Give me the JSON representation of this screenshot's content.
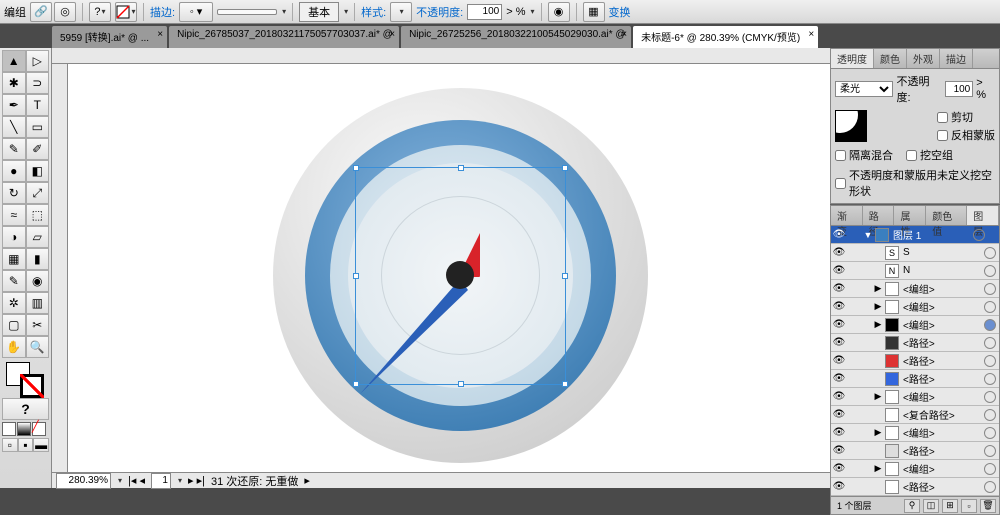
{
  "topbar": {
    "menu_label": "编组",
    "stroke_label": "描边:",
    "basic_label": "基本",
    "style_label": "样式:",
    "opacity_label": "不透明度:",
    "opacity_value": "100",
    "transform_label": "变换"
  },
  "tabs": [
    {
      "name": "5959 [转换].ai* @ ..."
    },
    {
      "name": "Nipic_26785037_20180321175057703037.ai* @"
    },
    {
      "name": "Nipic_26725256_20180322100545029030.ai* @"
    },
    {
      "name": "未标题-6* @ 280.39% (CMYK/预览)"
    }
  ],
  "active_tab": 3,
  "status": {
    "zoom": "280.39%",
    "page": "1",
    "undo_label": "31 次还原: 无重做"
  },
  "trans_panel": {
    "tabs": [
      "透明度",
      "颜色",
      "外观",
      "描边"
    ],
    "mode": "柔光",
    "opacity_label": "不透明度:",
    "opacity_value": "100",
    "clip_label": "剪切",
    "invert_label": "反相蒙版",
    "isolate_label": "隔离混合",
    "knockout_label": "挖空组",
    "mask_label": "不透明度和蒙版用未定义挖空形状"
  },
  "layers_panel": {
    "tabs": [
      "渐变",
      "路径",
      "属性",
      "颜色值",
      "图层"
    ],
    "active_tab": 4,
    "items": [
      {
        "name": "图层 1",
        "indent": 0,
        "expand": "▼",
        "sel": true,
        "thumb": "#3a7fc0"
      },
      {
        "name": "S",
        "indent": 1,
        "expand": "",
        "thumb": "#fff",
        "box": "S"
      },
      {
        "name": "N",
        "indent": 1,
        "expand": "",
        "thumb": "#fff",
        "box": "N"
      },
      {
        "name": "<编组>",
        "indent": 1,
        "expand": "▶",
        "thumb": "#fff"
      },
      {
        "name": "<编组>",
        "indent": 1,
        "expand": "▶",
        "thumb": "#fff"
      },
      {
        "name": "<编组>",
        "indent": 1,
        "expand": "▶",
        "thumb": "#000",
        "filled": true
      },
      {
        "name": "<路径>",
        "indent": 1,
        "expand": "",
        "thumb": "#333"
      },
      {
        "name": "<路径>",
        "indent": 1,
        "expand": "",
        "thumb": "#d33"
      },
      {
        "name": "<路径>",
        "indent": 1,
        "expand": "",
        "thumb": "#36d"
      },
      {
        "name": "<编组>",
        "indent": 1,
        "expand": "▶",
        "thumb": "#fff"
      },
      {
        "name": "<复合路径>",
        "indent": 1,
        "expand": "",
        "thumb": "#fff"
      },
      {
        "name": "<编组>",
        "indent": 1,
        "expand": "▶",
        "thumb": "#fff"
      },
      {
        "name": "<路径>",
        "indent": 1,
        "expand": "",
        "thumb": "#ddd"
      },
      {
        "name": "<编组>",
        "indent": 1,
        "expand": "▶",
        "thumb": "#fff"
      },
      {
        "name": "<路径>",
        "indent": 1,
        "expand": "",
        "thumb": "#fff"
      }
    ],
    "footer_label": "1 个图层"
  }
}
